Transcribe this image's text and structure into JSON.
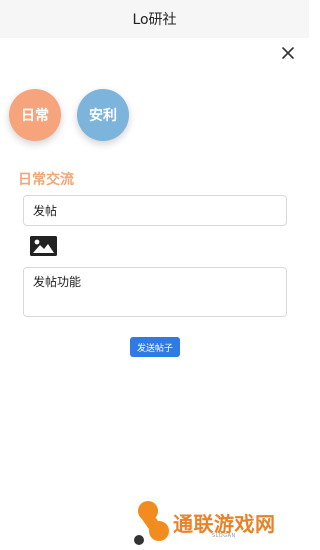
{
  "header": {
    "title": "Lo研社"
  },
  "close": {
    "icon": "close-icon"
  },
  "categories": [
    {
      "label": "日常",
      "color": "#f5a47c"
    },
    {
      "label": "安利",
      "color": "#7db4dc"
    }
  ],
  "section": {
    "title": "日常交流"
  },
  "form": {
    "title_value": "发帖",
    "image_icon": "image-icon",
    "content_value": "发帖功能",
    "submit_label": "发送帖子"
  },
  "watermark": {
    "brand": "通联游戏网",
    "slogan": "SLOGAN"
  },
  "colors": {
    "accent": "#2f7be6",
    "section_title": "#f0a87a",
    "brand": "#e8832a"
  }
}
